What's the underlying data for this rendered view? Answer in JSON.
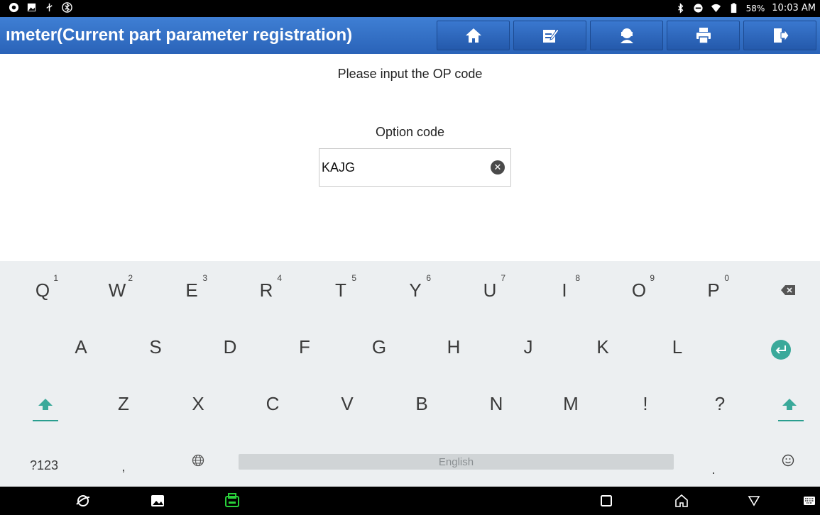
{
  "status_bar": {
    "battery": "58%",
    "time": "10:03 AM"
  },
  "title_bar": {
    "title": "ımeter(Current part parameter registration)",
    "buttons": [
      "home-icon",
      "edit-icon",
      "support-icon",
      "print-icon",
      "exit-icon"
    ]
  },
  "main": {
    "prompt": "Please input the OP code",
    "option_label": "Option code",
    "option_value": "KAJG"
  },
  "keyboard": {
    "row1": [
      {
        "key": "Q",
        "hint": "1"
      },
      {
        "key": "W",
        "hint": "2"
      },
      {
        "key": "E",
        "hint": "3"
      },
      {
        "key": "R",
        "hint": "4"
      },
      {
        "key": "T",
        "hint": "5"
      },
      {
        "key": "Y",
        "hint": "6"
      },
      {
        "key": "U",
        "hint": "7"
      },
      {
        "key": "I",
        "hint": "8"
      },
      {
        "key": "O",
        "hint": "9"
      },
      {
        "key": "P",
        "hint": "0"
      }
    ],
    "row2": [
      "A",
      "S",
      "D",
      "F",
      "G",
      "H",
      "J",
      "K",
      "L"
    ],
    "row3": [
      "Z",
      "X",
      "C",
      "V",
      "B",
      "N",
      "M",
      "!",
      "?"
    ],
    "row4": {
      "symbols": "?123",
      "comma": ",",
      "space": "English",
      "period": "."
    },
    "accent": "#3aa99a"
  }
}
